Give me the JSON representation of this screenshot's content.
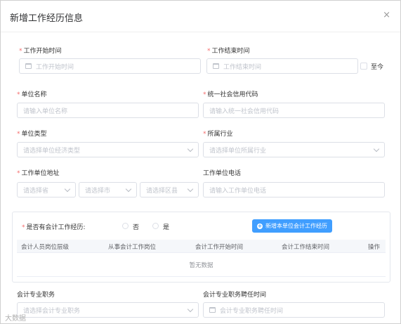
{
  "dialog": {
    "title": "新增工作经历信息",
    "close_symbol": "×"
  },
  "form": {
    "start_time": {
      "label": "工作开始时间",
      "placeholder": "工作开始时间"
    },
    "end_time": {
      "label": "工作结束时间",
      "placeholder": "工作结束时间"
    },
    "until_now_label": "至今",
    "unit_name": {
      "label": "单位名称",
      "placeholder": "请输入单位名称"
    },
    "credit_code": {
      "label": "统一社会信用代码",
      "placeholder": "请输入统一社会信用代码"
    },
    "unit_type": {
      "label": "单位类型",
      "placeholder": "请选择单位经济类型"
    },
    "industry": {
      "label": "所属行业",
      "placeholder": "请选择单位所属行业"
    },
    "address": {
      "label": "工作单位地址",
      "province": "请选择省",
      "city": "请选择市",
      "district": "请选择区县"
    },
    "phone": {
      "label": "工作单位电话",
      "placeholder": "请输入工作单位电话"
    },
    "accounting_experience": {
      "label": "是否有会计工作经历:",
      "options": [
        "否",
        "是"
      ],
      "add_button": "新增本单位会计工作经历",
      "table_headers": [
        "会计人员岗位层级",
        "从事会计工作岗位",
        "会计工作开始时间",
        "会计工作结束时间",
        "操作"
      ],
      "empty_text": "暂无数据"
    },
    "professional_title": {
      "label": "会计专业职务",
      "placeholder": "请选择会计专业职务"
    },
    "appointment_time": {
      "label": "会计专业职务聘任时间",
      "placeholder": "会计专业职务聘任时间"
    }
  },
  "watermark": "大数据"
}
